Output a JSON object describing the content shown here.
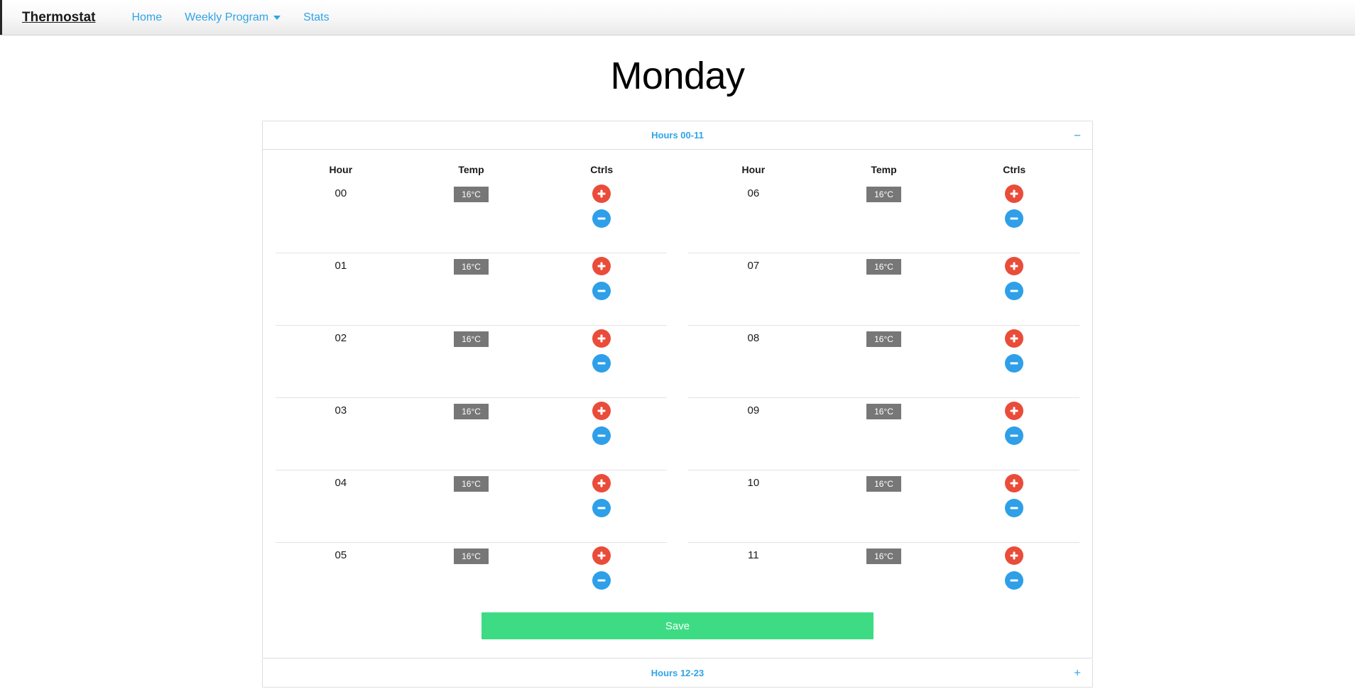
{
  "navbar": {
    "brand": "Thermostat",
    "links": [
      {
        "label": "Home",
        "has_caret": false
      },
      {
        "label": "Weekly Program",
        "has_caret": true
      },
      {
        "label": "Stats",
        "has_caret": false
      }
    ]
  },
  "page": {
    "title": "Monday"
  },
  "colors": {
    "link": "#2fa4e7",
    "increase": "#ea4c3a",
    "decrease": "#2e9fe8",
    "save": "#3ddc84",
    "badge": "#777777"
  },
  "panels": [
    {
      "title": "Hours 00-11",
      "toggle_sign": "−",
      "expanded": true
    },
    {
      "title": "Hours 12-23",
      "toggle_sign": "+",
      "expanded": false
    }
  ],
  "table": {
    "headers": {
      "hour": "Hour",
      "temp": "Temp",
      "ctrls": "Ctrls"
    },
    "left_column": [
      {
        "hour": "00",
        "temp": "16°C"
      },
      {
        "hour": "01",
        "temp": "16°C"
      },
      {
        "hour": "02",
        "temp": "16°C"
      },
      {
        "hour": "03",
        "temp": "16°C"
      },
      {
        "hour": "04",
        "temp": "16°C"
      },
      {
        "hour": "05",
        "temp": "16°C"
      }
    ],
    "right_column": [
      {
        "hour": "06",
        "temp": "16°C"
      },
      {
        "hour": "07",
        "temp": "16°C"
      },
      {
        "hour": "08",
        "temp": "16°C"
      },
      {
        "hour": "09",
        "temp": "16°C"
      },
      {
        "hour": "10",
        "temp": "16°C"
      },
      {
        "hour": "11",
        "temp": "16°C"
      }
    ],
    "increase_icon": "plus-icon",
    "decrease_icon": "minus-icon"
  },
  "actions": {
    "save_label": "Save"
  }
}
